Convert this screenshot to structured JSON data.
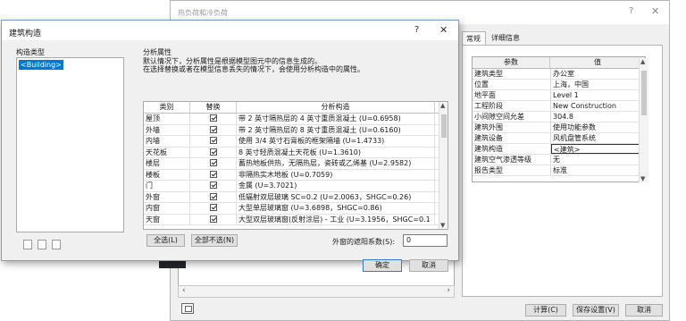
{
  "back_window": {
    "title": "热负荷和冷负荷",
    "help": "?",
    "close": "✕",
    "tabs": [
      "常规",
      "详细信息"
    ],
    "properties": {
      "headers": [
        "参数",
        "值"
      ],
      "rows": [
        [
          "建筑类型",
          "办公室"
        ],
        [
          "位置",
          "上海，中国"
        ],
        [
          "地平面",
          "Level 1"
        ],
        [
          "工程阶段",
          "New Construction"
        ],
        [
          "小间隙空间允差",
          "304.8"
        ],
        [
          "建筑外围",
          "使用功能参数"
        ],
        [
          "建筑设备",
          "风机盘管系统"
        ],
        [
          "建筑构造",
          "<建筑>"
        ],
        [
          "建筑空气渗透等级",
          "无"
        ],
        [
          "报告类型",
          "标准"
        ]
      ]
    },
    "buttons": {
      "calculate": "计算(C)",
      "save": "保存设置(V)",
      "cancel": "取消"
    }
  },
  "dialog": {
    "title": "建筑构造",
    "help": "?",
    "close": "✕",
    "type_label": "构造类型",
    "type_item": "<Building>",
    "analysis_label": "分析属性",
    "analysis_desc1": "默认情况下，分析属性是根据模型图元中的信息生成的。",
    "analysis_desc2": "在选择替换或者在模型信息丢失的情况下，会使用分析构造中的属性。",
    "columns": [
      "类别",
      "替换",
      "分析构造"
    ],
    "rows": [
      {
        "category": "屋顶",
        "override": true,
        "construction": "带 2 英寸隔热层的 4 英寸重质混凝土 (U=0.6958)"
      },
      {
        "category": "外墙",
        "override": true,
        "construction": "带 2 英寸隔热层的 8 英寸重质混凝土 (U=0.6160)"
      },
      {
        "category": "内墙",
        "override": true,
        "construction": "使用 3/4 英寸石膏板的框架隔墙 (U=1.4733)"
      },
      {
        "category": "天花板",
        "override": true,
        "construction": "8 英寸轻质混凝土天花板 (U=1.3610)"
      },
      {
        "category": "楼层",
        "override": true,
        "construction": "蓄热地板供热，无隔热层，瓷砖或乙烯基 (U=2.9582)"
      },
      {
        "category": "楼板",
        "override": true,
        "construction": "非隔热实木地板 (U=0.7059)"
      },
      {
        "category": "门",
        "override": true,
        "construction": "金属 (U=3.7021)"
      },
      {
        "category": "外窗",
        "override": true,
        "construction": "低辐射双层玻璃 SC=0.2 (U=2.0063，SHGC=0.26)"
      },
      {
        "category": "内窗",
        "override": true,
        "construction": "大型单层玻璃窗 (U=3.6898，SHGC=0.86)"
      },
      {
        "category": "天窗",
        "override": true,
        "construction": "大型双层玻璃窗(反射涂层) - 工业 (U=3.1956，SHGC=0.1"
      }
    ],
    "select_all": "全选(L)",
    "select_none": "全部不选(N)",
    "shade_label": "外窗的遮阳系数(S):",
    "shade_value": "0",
    "ok": "确定",
    "cancel": "取消"
  }
}
